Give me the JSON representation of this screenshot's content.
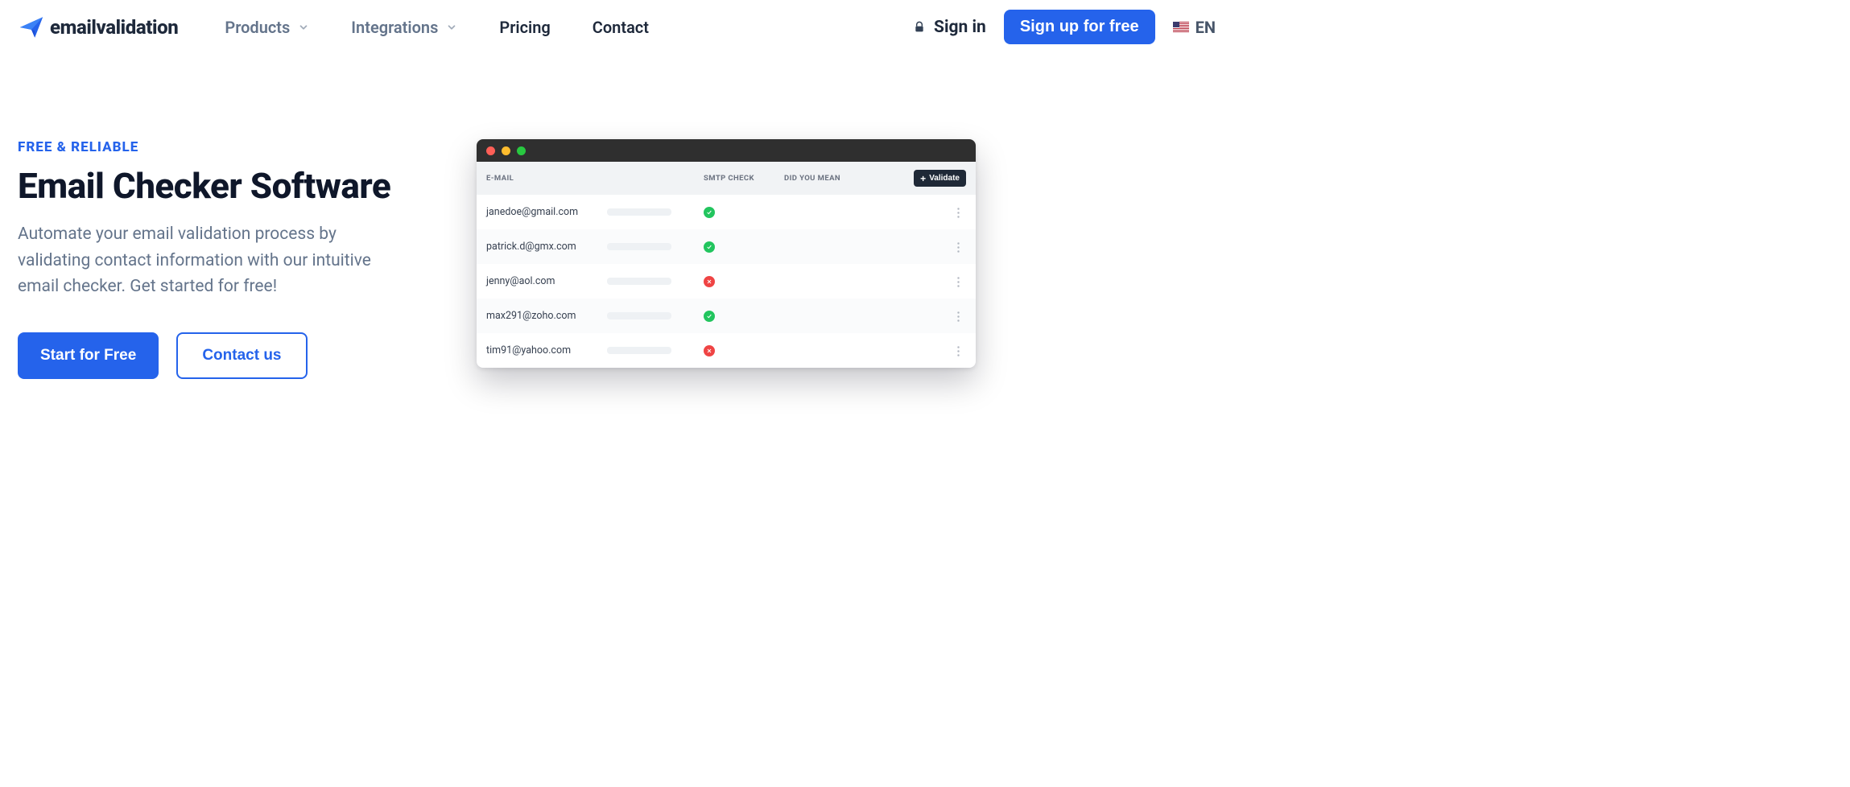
{
  "brand": "emailvalidation",
  "nav": {
    "products": "Products",
    "integrations": "Integrations",
    "pricing": "Pricing",
    "contact": "Contact",
    "signin": "Sign in",
    "signup": "Sign up for free",
    "lang": "EN"
  },
  "hero": {
    "kicker": "FREE & RELIABLE",
    "title": "Email Checker Software",
    "lead": "Automate your email validation process by validating contact information with our intuitive email checker. Get started for free!",
    "cta_primary": "Start for Free",
    "cta_secondary": "Contact us"
  },
  "mock": {
    "headers": {
      "email": "E-MAIL",
      "smtp": "SMTP CHECK",
      "mean": "DID YOU MEAN"
    },
    "validate": "Validate",
    "rows": [
      {
        "email": "janedoe@gmail.com",
        "smtp": "ok"
      },
      {
        "email": "patrick.d@gmx.com",
        "smtp": "ok"
      },
      {
        "email": "jenny@aol.com",
        "smtp": "bad"
      },
      {
        "email": "max291@zoho.com",
        "smtp": "ok"
      },
      {
        "email": "tim91@yahoo.com",
        "smtp": "bad"
      }
    ]
  }
}
